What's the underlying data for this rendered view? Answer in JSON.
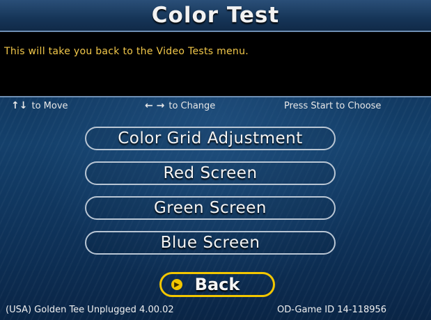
{
  "header": {
    "title": "Color Test"
  },
  "message": "This will take you back to the Video Tests menu.",
  "hints": {
    "move_icon": "up-down-arrows",
    "move_text": "to Move",
    "change_icon": "left-right-arrows",
    "change_text": "to Change",
    "start_text": "Press Start to Choose"
  },
  "menu": {
    "items": [
      {
        "label": "Color Grid Adjustment"
      },
      {
        "label": "Red Screen"
      },
      {
        "label": "Green Screen"
      },
      {
        "label": "Blue Screen"
      }
    ],
    "back_label": "Back",
    "selected": "Back"
  },
  "footer": {
    "version": "(USA) Golden Tee Unplugged 4.00.02",
    "game_id": "OD-Game ID 14-118956"
  },
  "colors": {
    "message_text": "#f2c84a",
    "selected_border": "#f2c600",
    "item_border": "#b9c6d4"
  }
}
